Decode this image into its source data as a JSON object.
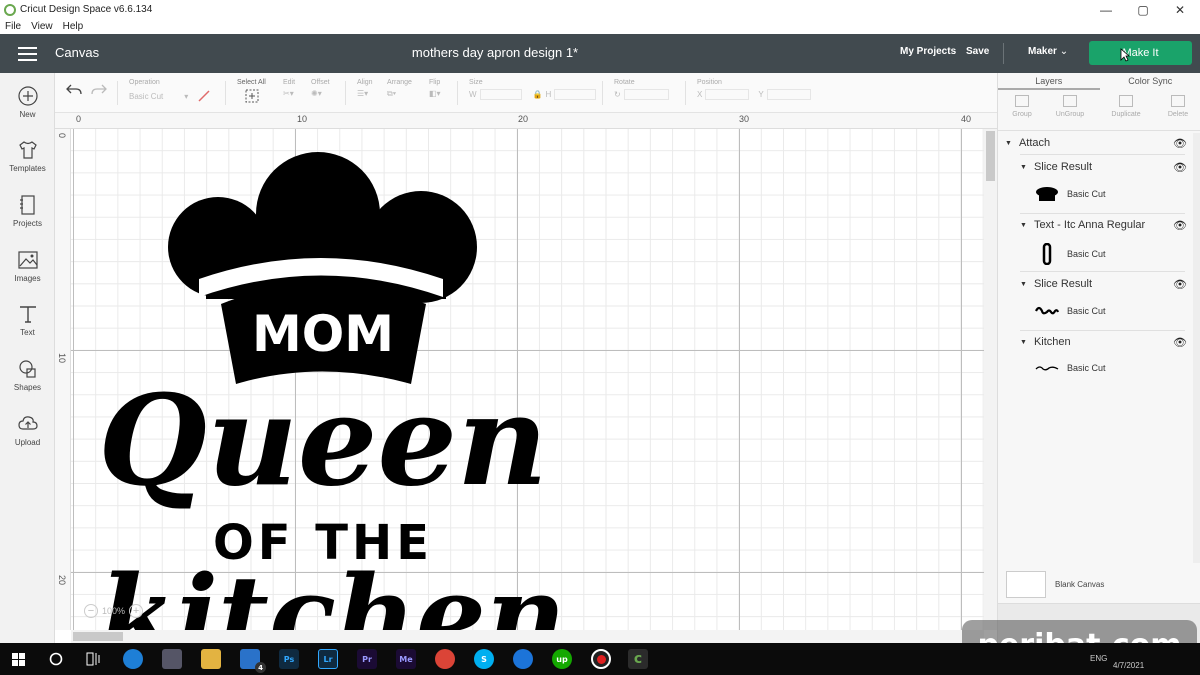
{
  "window": {
    "app_title": "Cricut Design Space  v6.6.134",
    "minimize": "—",
    "maximize": "▢",
    "close": "✕"
  },
  "menu": {
    "items": [
      "File",
      "View",
      "Help"
    ]
  },
  "header": {
    "canvas_label": "Canvas",
    "doc_title": "mothers day apron design 1*",
    "my_projects": "My Projects",
    "save": "Save",
    "machine": "Maker",
    "make_it": "Make It"
  },
  "leftnav": [
    "New",
    "Templates",
    "Projects",
    "Images",
    "Text",
    "Shapes",
    "Upload"
  ],
  "toolbar": {
    "operation_label": "Operation",
    "operation_value": "Basic Cut",
    "select_all": "Select All",
    "edit": "Edit",
    "offset": "Offset",
    "align": "Align",
    "arrange": "Arrange",
    "flip": "Flip",
    "size": "Size",
    "w": "W",
    "h": "H",
    "rotate": "Rotate",
    "position": "Position",
    "x": "X",
    "y": "Y"
  },
  "ruler": {
    "top": [
      "0",
      "10",
      "20",
      "30",
      "40"
    ],
    "left": [
      "0",
      "10",
      "20"
    ]
  },
  "zoom": {
    "value": "100%",
    "minus": "−",
    "plus": "+"
  },
  "panel": {
    "tabs": [
      "Layers",
      "Color Sync"
    ],
    "actions": [
      "Group",
      "UnGroup",
      "Duplicate",
      "Delete"
    ],
    "attach": "Attach",
    "layers": [
      {
        "name": "Slice Result",
        "op": "Basic Cut"
      },
      {
        "name": "Text - Itc Anna Regular",
        "op": "Basic Cut"
      },
      {
        "name": "Slice Result",
        "op": "Basic Cut"
      },
      {
        "name": "Kitchen",
        "op": "Basic Cut"
      }
    ],
    "blank_canvas": "Blank Canvas"
  },
  "design": {
    "hat_text": "MOM",
    "line1": "Queen",
    "line2": "OF THE",
    "line3": "kitchen"
  },
  "taskbar": {
    "apps": [
      "Ps",
      "Lr",
      "Pr",
      "Me"
    ],
    "mail_badge": "4",
    "lang": "ENG",
    "date": "4/7/2021"
  },
  "watermark": "peribat.com",
  "colors": {
    "header": "#414a4f",
    "make_it": "#1aa36a",
    "taskbar": "#0b0b0b"
  }
}
